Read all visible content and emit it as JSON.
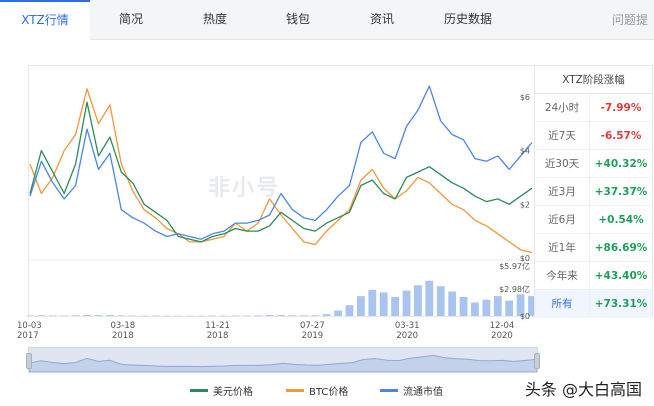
{
  "tabs": [
    {
      "label": "XTZ行情",
      "active": true
    },
    {
      "label": "简况",
      "active": false
    },
    {
      "label": "热度",
      "active": false
    },
    {
      "label": "钱包",
      "active": false
    },
    {
      "label": "资讯",
      "active": false
    },
    {
      "label": "历史数据",
      "active": false
    }
  ],
  "tab_more": "问题提",
  "watermark": "非小号",
  "corner_watermark": "头条 @大白高国",
  "performance": {
    "title": "XTZ阶段涨幅",
    "rows": [
      {
        "period": "24小时",
        "value": "-7.99%",
        "color": "#e03b3b"
      },
      {
        "period": "近7天",
        "value": "-6.57%",
        "color": "#e03b3b"
      },
      {
        "period": "近30天",
        "value": "+40.32%",
        "color": "#1e9e5a"
      },
      {
        "period": "近3月",
        "value": "+37.37%",
        "color": "#1e9e5a"
      },
      {
        "period": "近6月",
        "value": "+0.54%",
        "color": "#1e9e5a"
      },
      {
        "period": "近1年",
        "value": "+86.69%",
        "color": "#1e9e5a"
      },
      {
        "period": "今年来",
        "value": "+43.40%",
        "color": "#1e9e5a"
      },
      {
        "period": "所有",
        "value": "+73.31%",
        "color": "#1e9e5a",
        "active": true
      }
    ]
  },
  "colors": {
    "usd": "#2e8b57",
    "btc": "#f0963c",
    "mcap": "#4a86e0",
    "volume": "#a9c4ef",
    "accent": "#2f6ee8"
  },
  "chart_data": {
    "type": "line",
    "x_ticks": [
      {
        "month": "10-03",
        "year": "2017"
      },
      {
        "month": "03-18",
        "year": "2018"
      },
      {
        "month": "11-21",
        "year": "2018"
      },
      {
        "month": "07-27",
        "year": "2019"
      },
      {
        "month": "03-31",
        "year": "2020"
      },
      {
        "month": "12-04",
        "year": "2020"
      }
    ],
    "y_ticks_price": [
      "$6",
      "$4",
      "$2",
      "$0"
    ],
    "y_ticks_volume": [
      "$5.97亿",
      "$2.98亿",
      "$0"
    ],
    "ylim_price": [
      0,
      7
    ],
    "ylim_volume": [
      0,
      5.97
    ],
    "series": [
      {
        "name": "美元价格",
        "key": "usd",
        "values": [
          2.4,
          4.0,
          3.2,
          2.4,
          3.5,
          5.8,
          3.8,
          4.5,
          3.2,
          2.8,
          2.0,
          1.7,
          1.4,
          0.8,
          0.7,
          0.6,
          0.8,
          0.9,
          1.1,
          1.0,
          1.0,
          1.2,
          1.7,
          1.4,
          1.1,
          1.0,
          1.3,
          1.5,
          1.7,
          2.7,
          2.9,
          2.4,
          2.2,
          3.0,
          3.2,
          3.4,
          3.1,
          2.8,
          2.6,
          2.3,
          2.1,
          2.2,
          2.0,
          2.3,
          2.6
        ]
      },
      {
        "name": "BTC价格",
        "key": "btc",
        "values": [
          3.5,
          2.4,
          3.0,
          4.0,
          4.6,
          6.3,
          5.0,
          5.7,
          3.5,
          2.5,
          1.8,
          1.5,
          1.1,
          0.9,
          0.6,
          0.6,
          0.7,
          0.8,
          1.3,
          1.0,
          1.3,
          2.2,
          1.6,
          1.1,
          0.6,
          0.5,
          1.0,
          1.4,
          1.8,
          2.9,
          3.3,
          2.6,
          2.2,
          2.5,
          3.0,
          2.8,
          2.4,
          2.0,
          1.8,
          1.4,
          1.2,
          0.9,
          0.6,
          0.3,
          0.2
        ]
      },
      {
        "name": "流通市值",
        "key": "mcap",
        "values": [
          2.3,
          3.6,
          2.8,
          2.2,
          2.7,
          4.8,
          3.3,
          3.9,
          1.8,
          1.5,
          1.3,
          1.0,
          0.8,
          0.9,
          0.8,
          0.7,
          0.9,
          1.0,
          1.3,
          1.3,
          1.4,
          1.6,
          2.4,
          1.8,
          1.5,
          1.4,
          1.8,
          2.3,
          2.7,
          4.3,
          4.7,
          3.9,
          3.7,
          4.9,
          5.5,
          6.4,
          5.1,
          4.6,
          4.4,
          3.7,
          3.6,
          3.8,
          3.3,
          3.8,
          4.3
        ]
      },
      {
        "name": "成交量",
        "key": "volume",
        "values": [
          0.05,
          0.08,
          0.06,
          0.05,
          0.07,
          0.12,
          0.09,
          0.1,
          0.06,
          0.05,
          0.04,
          0.04,
          0.03,
          0.03,
          0.03,
          0.03,
          0.04,
          0.04,
          0.06,
          0.05,
          0.07,
          0.12,
          0.1,
          0.08,
          0.07,
          0.08,
          0.2,
          0.6,
          1.2,
          2.2,
          2.9,
          2.6,
          2.1,
          2.8,
          3.4,
          3.9,
          3.3,
          2.7,
          2.1,
          1.5,
          1.8,
          2.2,
          1.7,
          2.4,
          2.2
        ]
      }
    ],
    "legend": [
      {
        "name": "美元价格",
        "key": "usd"
      },
      {
        "name": "BTC价格",
        "key": "btc"
      },
      {
        "name": "流通市值",
        "key": "mcap"
      }
    ],
    "grid": false,
    "legend_position": "bottom"
  }
}
